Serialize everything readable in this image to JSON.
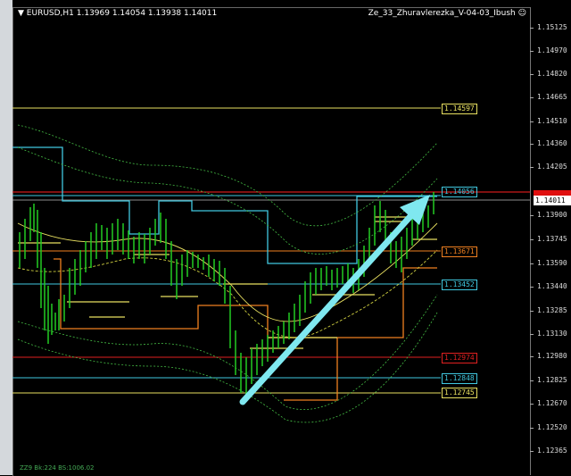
{
  "chart_header": {
    "symbol_text": "EURUSD,H1  1.13969 1.14054 1.13938 1.14011",
    "indicator_text": "Ze_33_Zhuravlerezka_V-04-03_Ibush",
    "indicator_icon": "smiley-icon"
  },
  "axis_ticks": [
    "1.15125",
    "1.14970",
    "1.14820",
    "1.14665",
    "1.14510",
    "1.14360",
    "1.14205",
    "1.13900",
    "1.13745",
    "1.13590",
    "1.13440",
    "1.13285",
    "1.13130",
    "1.12980",
    "1.12825",
    "1.12670",
    "1.12520",
    "1.12365"
  ],
  "current_price": "1.14011",
  "level_labels": [
    {
      "text": "1.14597",
      "color": "#e8e060"
    },
    {
      "text": "1.14056",
      "color": "#40c8e0"
    },
    {
      "text": "1.13671",
      "color": "#f08020"
    },
    {
      "text": "1.13452",
      "color": "#40c8e0"
    },
    {
      "text": "1.12974",
      "color": "#e02020"
    },
    {
      "text": "1.12848",
      "color": "#40c8e0"
    },
    {
      "text": "1.12745",
      "color": "#e8e060"
    }
  ],
  "status_text": "ZZ9 Bk:224 BS:1006.02",
  "colors": {
    "background": "#000000",
    "candles": "#22cc22",
    "arrow": "#7fe8f0",
    "band": "#44bb44"
  }
}
